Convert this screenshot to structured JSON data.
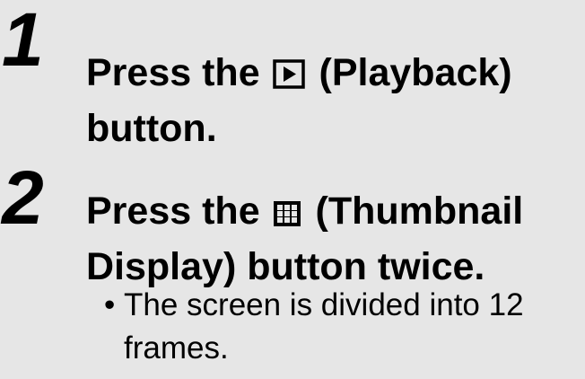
{
  "steps": [
    {
      "number": "1",
      "line1_before": "Press the",
      "line1_icon": "playback-icon",
      "line1_after": "(Playback)",
      "line2": "button."
    },
    {
      "number": "2",
      "line1_before": "Press the",
      "line1_icon": "thumbnail-display-icon",
      "line1_after": "(Thumbnail",
      "line2": "Display) button twice."
    }
  ],
  "notes": [
    {
      "bullet": "•",
      "line1": "The screen is divided into 12",
      "line2": "frames."
    }
  ],
  "colors": {
    "background": "#e6e6e6",
    "text": "#000000"
  }
}
